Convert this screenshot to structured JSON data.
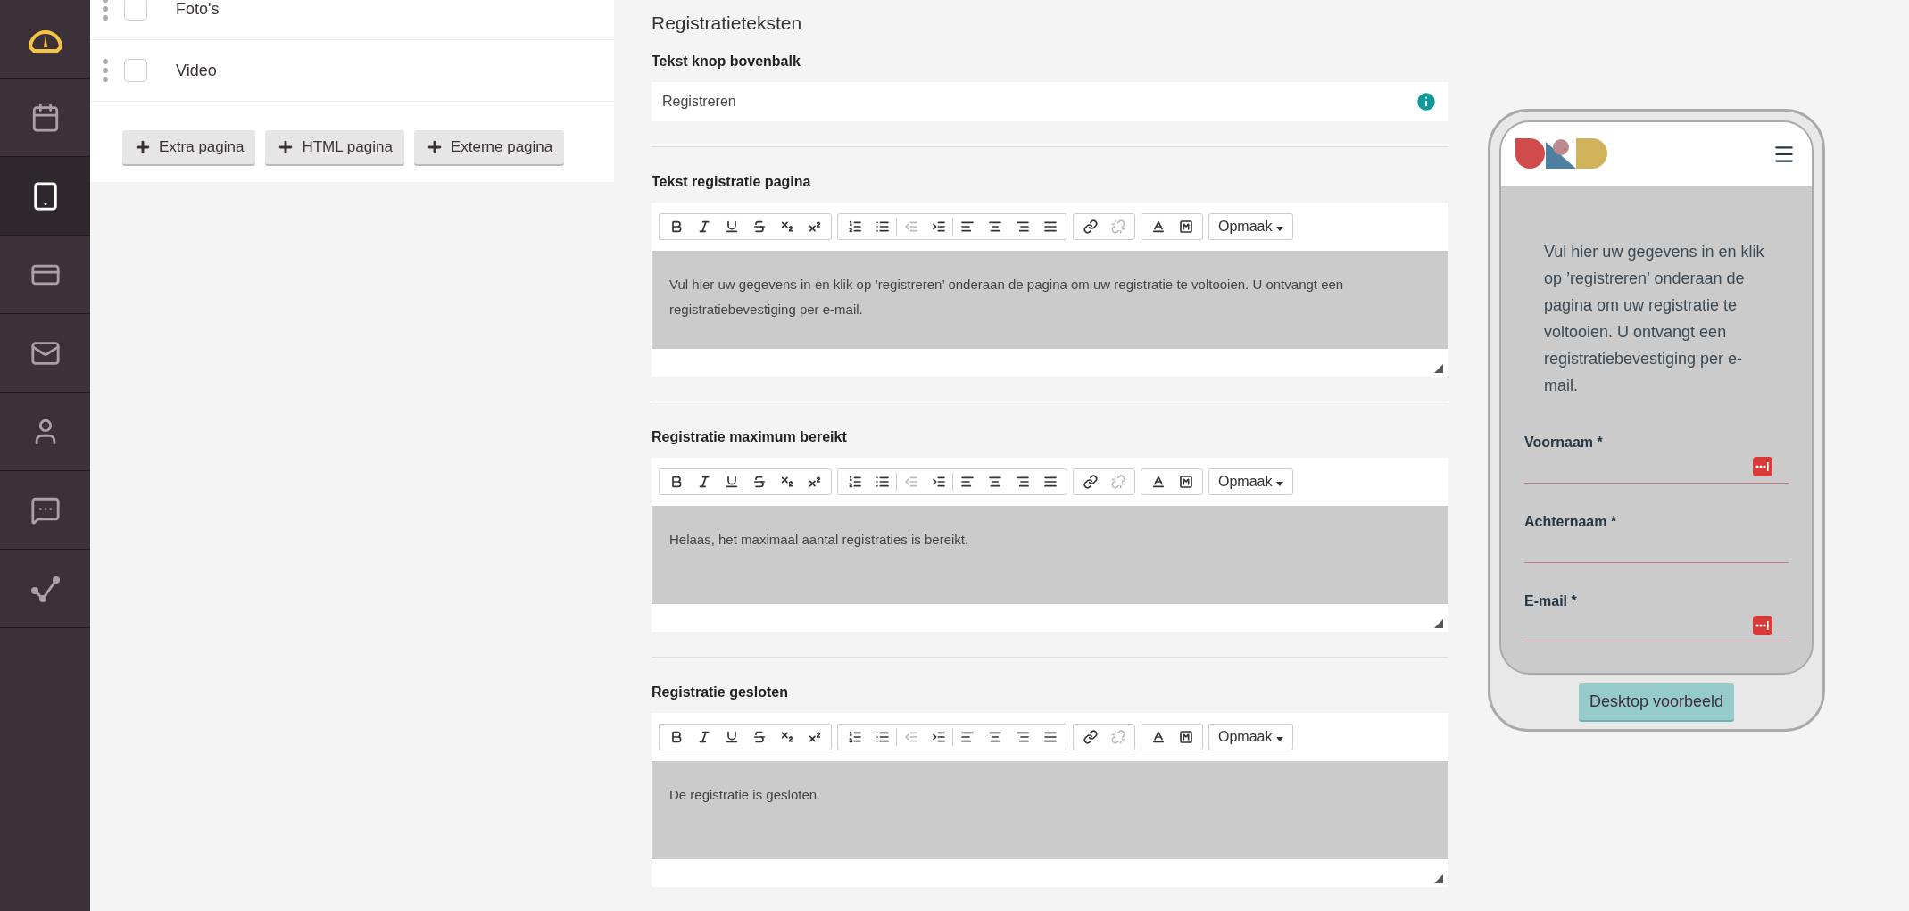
{
  "sidebar": {
    "items": [
      {
        "selected": false
      },
      {
        "selected": false
      },
      {
        "selected": true
      },
      {
        "selected": false
      },
      {
        "selected": false
      },
      {
        "selected": false
      },
      {
        "selected": false
      },
      {
        "selected": false
      }
    ]
  },
  "pages": {
    "items": [
      {
        "label": "Foto's",
        "checked": false
      },
      {
        "label": "Video",
        "checked": false
      }
    ],
    "buttons": [
      "Extra pagina",
      "HTML pagina",
      "Externe pagina"
    ]
  },
  "registration_texts": {
    "title": "Registratieteksten",
    "button_text_field": {
      "label": "Tekst knop bovenbalk",
      "value": "Registreren"
    },
    "editors": [
      {
        "label": "Tekst registratie pagina",
        "format_dropdown": "Opmaak",
        "text": "Vul hier uw gegevens in en klik op ’registreren’ onderaan de pagina om uw registratie te voltooien. U ontvangt een registratiebevestiging per e-mail."
      },
      {
        "label": "Registratie maximum bereikt",
        "format_dropdown": "Opmaak",
        "text": "Helaas, het maximaal aantal registraties is bereikt."
      },
      {
        "label": "Registratie gesloten",
        "format_dropdown": "Opmaak",
        "text": "De registratie is gesloten."
      }
    ]
  },
  "phone_preview": {
    "intro": "Vul hier uw gegevens in en klik op ’registreren’ onderaan de pagina om uw registratie te voltooien. U ontvangt een registratiebevestiging per e-mail.",
    "fields": [
      {
        "label": "Voornaam *",
        "autofill_icon": true
      },
      {
        "label": "Achternaam *",
        "autofill_icon": false
      },
      {
        "label": "E-mail *",
        "autofill_icon": true
      }
    ],
    "button": "Desktop voorbeeld"
  }
}
